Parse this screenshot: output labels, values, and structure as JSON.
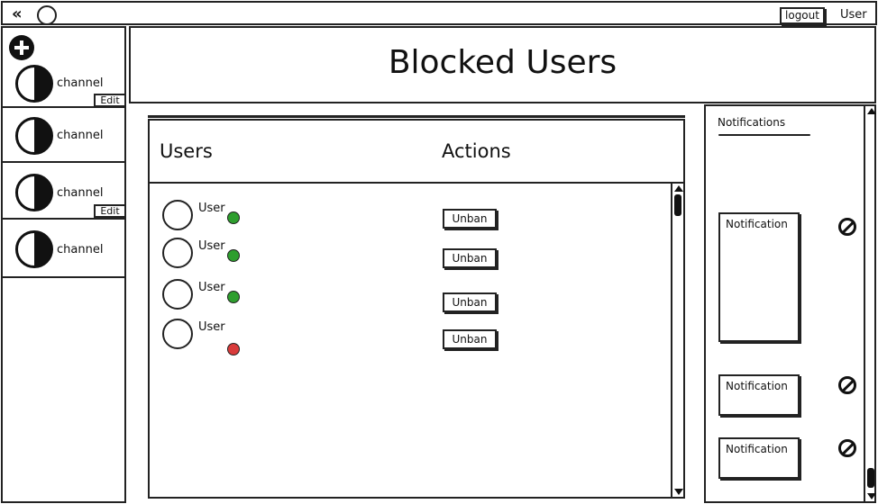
{
  "topbar": {
    "back_icon": "double-chevron-left-icon",
    "logout_label": "logout",
    "user_label": "User"
  },
  "sidebar": {
    "add_icon": "plus-circle-icon",
    "channels": [
      {
        "label": "channel",
        "edit_label": "Edit"
      },
      {
        "label": "channel"
      },
      {
        "label": "channel",
        "edit_label": "Edit"
      },
      {
        "label": "channel"
      }
    ]
  },
  "header": {
    "title": "Blocked Users"
  },
  "main": {
    "columns": [
      "Users",
      "Actions"
    ],
    "rows": [
      {
        "user": "User",
        "status": "online",
        "status_color": "#2e9e2e",
        "action": "Unban"
      },
      {
        "user": "User",
        "status": "online",
        "status_color": "#2e9e2e",
        "action": "Unban"
      },
      {
        "user": "User",
        "status": "online",
        "status_color": "#2e9e2e",
        "action": "Unban"
      },
      {
        "user": "User",
        "status": "offline",
        "status_color": "#d93b3b",
        "action": "Unban"
      }
    ]
  },
  "notifications": {
    "title": "Notifications",
    "items": [
      {
        "label": "Notification",
        "icon": "block-icon"
      },
      {
        "label": "Notification",
        "icon": "block-icon"
      },
      {
        "label": "Notification",
        "icon": "block-icon"
      }
    ]
  }
}
